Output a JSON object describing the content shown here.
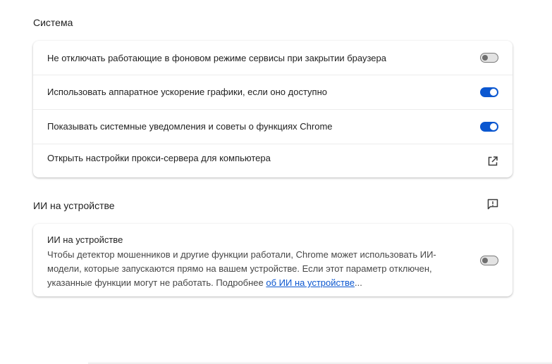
{
  "system": {
    "title": "Система",
    "rows": [
      {
        "label": "Не отключать работающие в фоновом режиме сервисы при закрытии браузера",
        "enabled": false
      },
      {
        "label": "Использовать аппаратное ускорение графики, если оно доступно",
        "enabled": true
      },
      {
        "label": "Показывать системные уведомления и советы о функциях Chrome",
        "enabled": true
      },
      {
        "label": "Открыть настройки прокси-сервера для компьютера",
        "icon": "open-in-new-icon"
      }
    ]
  },
  "ai": {
    "title": "ИИ на устройстве",
    "feedback_icon": "feedback-icon",
    "card_title": "ИИ на устройстве",
    "desc_text": "Чтобы детектор мошенников и другие функции работали, Chrome может использовать ИИ-модели, которые запускаются прямо на вашем устройстве. Если этот параметр отключен, указанные функции могут не работать. Подробнее ",
    "link_text": "об ИИ на устройстве",
    "ellipsis": "...",
    "enabled": false
  },
  "colors": {
    "accent": "#0b57d0",
    "toggle_off": "#e3e3e3"
  }
}
